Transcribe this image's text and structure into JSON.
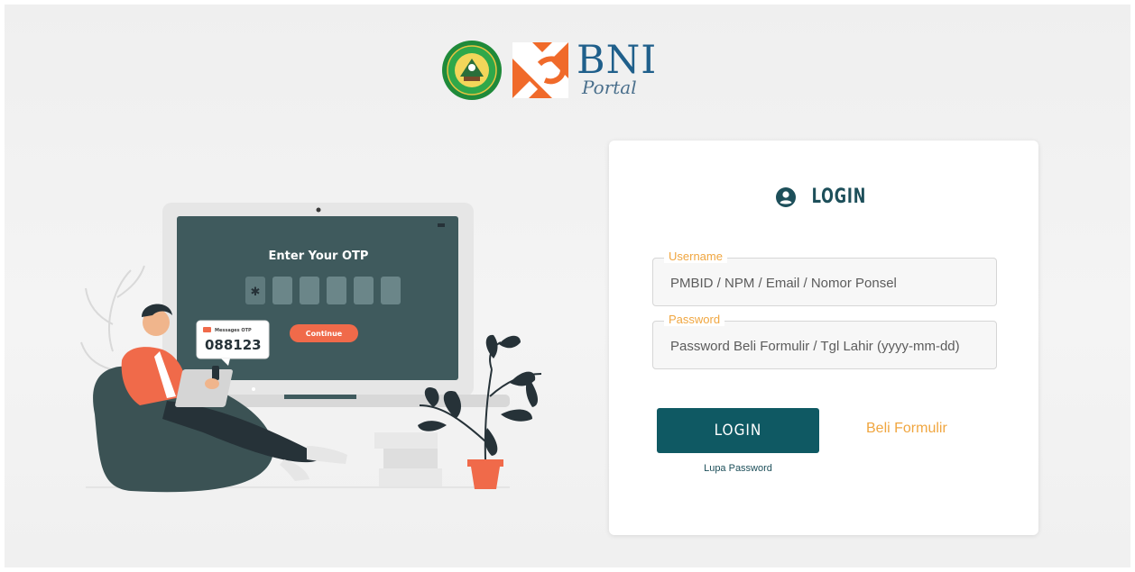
{
  "header": {
    "brand_name": "BNI",
    "brand_sub": "Portal",
    "emblem_icon": "university-emblem-logo",
    "bni_icon": "bni-logo-mark"
  },
  "illustration": {
    "screen_title": "Enter Your OTP",
    "otp_first_char": "✱",
    "continue_label": "Continue",
    "message_label": "Messages OTP",
    "otp_code": "088123"
  },
  "login": {
    "title": "LOGIN",
    "title_icon": "user-circle-icon",
    "username_label": "Username",
    "username_placeholder": "PMBID / NPM / Email / Nomor Ponsel",
    "password_label": "Password",
    "password_placeholder": "Password Beli Formulir / Tgl Lahir (yyyy-mm-dd)",
    "submit_label": "LOGIN",
    "buy_form_label": "Beli Formulir",
    "forgot_label": "Lupa Password"
  },
  "colors": {
    "primary": "#0f5963",
    "accent": "#f0a640",
    "orange": "#f06a4a",
    "brand_blue": "#1f5f8b"
  }
}
